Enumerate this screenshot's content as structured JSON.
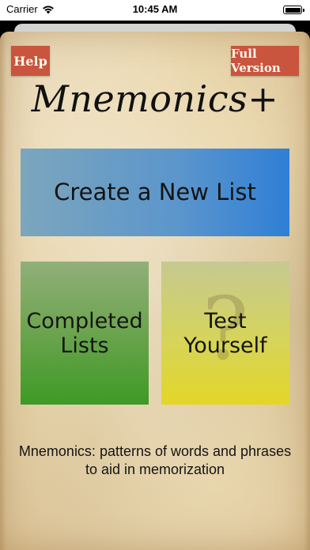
{
  "status_bar": {
    "carrier": "Carrier",
    "time": "10:45 AM",
    "wifi_icon": "wifi-icon",
    "battery_icon": "battery-icon"
  },
  "header": {
    "help_label": "Help",
    "full_version_label": "Full Version",
    "app_title": "Mnemonics+"
  },
  "tiles": {
    "create_new_list": "Create a New List",
    "completed_lists_line1": "Completed",
    "completed_lists_line2": "Lists",
    "test_yourself_line1": "Test",
    "test_yourself_line2": "Yourself",
    "test_background_glyph": "?"
  },
  "tagline": "Mnemonics: patterns of words and phrases to aid in memorization",
  "colors": {
    "button_red": "#c9553f",
    "create_tile": "#5a95cc",
    "completed_tile": "#6fa552",
    "test_tile": "#d6d45a",
    "parchment": "#ead8b0"
  }
}
